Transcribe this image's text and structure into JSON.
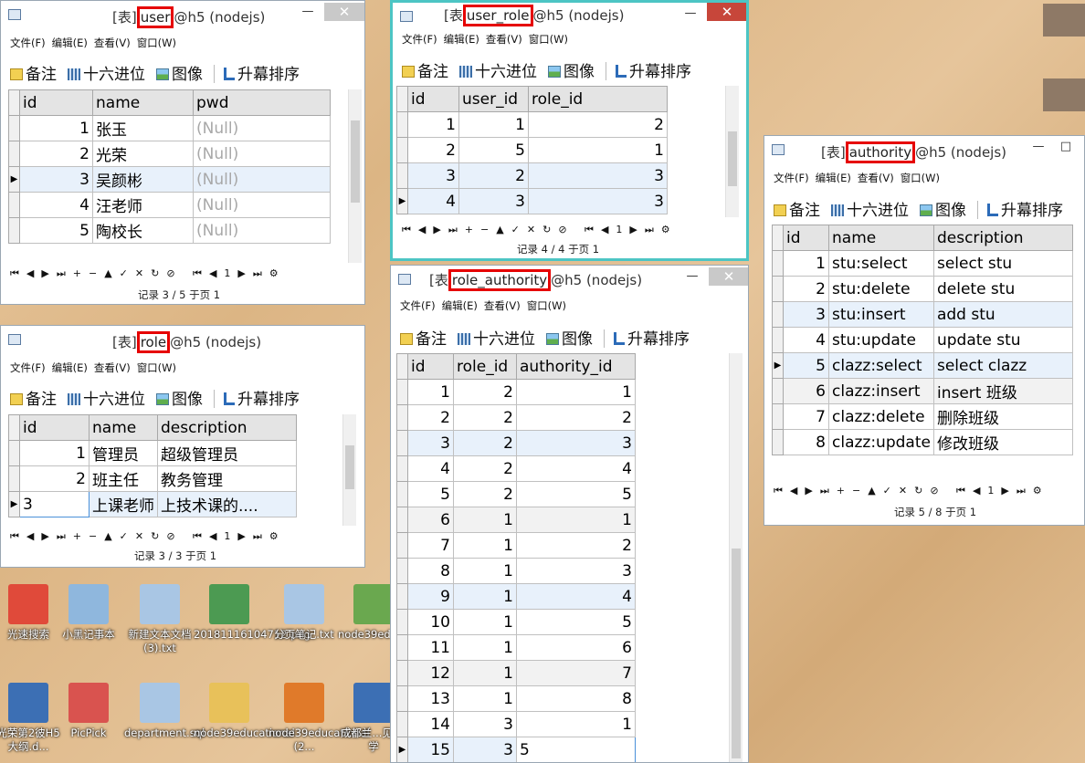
{
  "menu": [
    "文件(F)",
    "编辑(E)",
    "查看(V)",
    "窗口(W)"
  ],
  "toolbar": {
    "memo": "备注",
    "hex": "十六进位",
    "image": "图像",
    "sort": "升幕排序"
  },
  "nav_glyphs": [
    "⏮",
    "◀",
    "▶",
    "⏭",
    "+",
    "−",
    "▲",
    "✓",
    "✕",
    "↻",
    "⊘"
  ],
  "nav_page_glyphs": [
    "⏮",
    "◀",
    "1",
    "▶",
    "⏭",
    "⚙"
  ],
  "windows": {
    "user": {
      "title_prefix": "[表]",
      "table_name": "user",
      "title_suffix": "@h5 (nodejs)",
      "columns": [
        "id",
        "name",
        "pwd"
      ],
      "rows": [
        [
          "1",
          "张玉",
          "(Null)"
        ],
        [
          "2",
          "光荣",
          "(Null)"
        ],
        [
          "3",
          "吴颜彬",
          "(Null)"
        ],
        [
          "4",
          "汪老师",
          "(Null)"
        ],
        [
          "5",
          "陶校长",
          "(Null)"
        ]
      ],
      "status": "记录 3 / 5 于页 1"
    },
    "role": {
      "title_prefix": "[表]",
      "table_name": "role",
      "title_suffix": "@h5 (nodejs)",
      "columns": [
        "id",
        "name",
        "description"
      ],
      "rows": [
        [
          "1",
          "管理员",
          "超级管理员"
        ],
        [
          "2",
          "班主任",
          "教务管理"
        ],
        [
          "3",
          "上课老师",
          "上技术课的...."
        ]
      ],
      "status": "记录 3 / 3 于页 1"
    },
    "user_role": {
      "title_prefix": "[表",
      "table_name": "user_role",
      "title_suffix": "@h5 (nodejs)",
      "columns": [
        "id",
        "user_id",
        "role_id"
      ],
      "rows": [
        [
          "1",
          "1",
          "2"
        ],
        [
          "2",
          "5",
          "1"
        ],
        [
          "3",
          "2",
          "3"
        ],
        [
          "4",
          "3",
          "3"
        ]
      ],
      "status": "记录 4 / 4 于页 1"
    },
    "role_authority": {
      "title_prefix": "[表",
      "table_name": "role_authority",
      "title_suffix": "@h5 (nodejs)",
      "columns": [
        "id",
        "role_id",
        "authority_id"
      ],
      "rows": [
        [
          "1",
          "2",
          "1"
        ],
        [
          "2",
          "2",
          "2"
        ],
        [
          "3",
          "2",
          "3"
        ],
        [
          "4",
          "2",
          "4"
        ],
        [
          "5",
          "2",
          "5"
        ],
        [
          "6",
          "1",
          "1"
        ],
        [
          "7",
          "1",
          "2"
        ],
        [
          "8",
          "1",
          "3"
        ],
        [
          "9",
          "1",
          "4"
        ],
        [
          "10",
          "1",
          "5"
        ],
        [
          "11",
          "1",
          "6"
        ],
        [
          "12",
          "1",
          "7"
        ],
        [
          "13",
          "1",
          "8"
        ],
        [
          "14",
          "3",
          "1"
        ],
        [
          "15",
          "3",
          "5"
        ]
      ]
    },
    "authority": {
      "title_prefix": "[表]",
      "table_name": "authority",
      "title_suffix": "@h5 (nodejs)",
      "columns": [
        "id",
        "name",
        "description"
      ],
      "rows": [
        [
          "1",
          "stu:select",
          "select stu"
        ],
        [
          "2",
          "stu:delete",
          "delete stu"
        ],
        [
          "3",
          "stu:insert",
          "add stu"
        ],
        [
          "4",
          "stu:update",
          "update stu"
        ],
        [
          "5",
          "clazz:select",
          "select clazz"
        ],
        [
          "6",
          "clazz:insert",
          "insert 班级"
        ],
        [
          "7",
          "clazz:delete",
          "删除班级"
        ],
        [
          "8",
          "clazz:update",
          "修改班级"
        ]
      ],
      "status": "记录 5 / 8 于页 1"
    }
  },
  "desktop_icons": [
    {
      "label": "光速搜索",
      "color": "#e04a3a"
    },
    {
      "label": "小黑记事本",
      "color": "#8fb7dd"
    },
    {
      "label": "新建文本文档 (3).txt",
      "color": "#a9c6e4"
    },
    {
      "label": "20181116104712.png",
      "color": "#4c9a52"
    },
    {
      "label": "分页笔记.txt",
      "color": "#a9c6e4"
    },
    {
      "label": "node39educational",
      "color": "#6aa84f"
    },
    {
      "label": "光荣第2彼H5大纲.d...",
      "color": "#3c6fb4"
    },
    {
      "label": "PicPick",
      "color": "#d9534f"
    },
    {
      "label": "department.sql",
      "color": "#a9c6e4"
    },
    {
      "label": "node39educational",
      "color": "#e8c15a"
    },
    {
      "label": "node39educational (2...",
      "color": "#e07a2a"
    },
    {
      "label": "成都兰...见 教学",
      "color": "#3c6fb4"
    }
  ]
}
